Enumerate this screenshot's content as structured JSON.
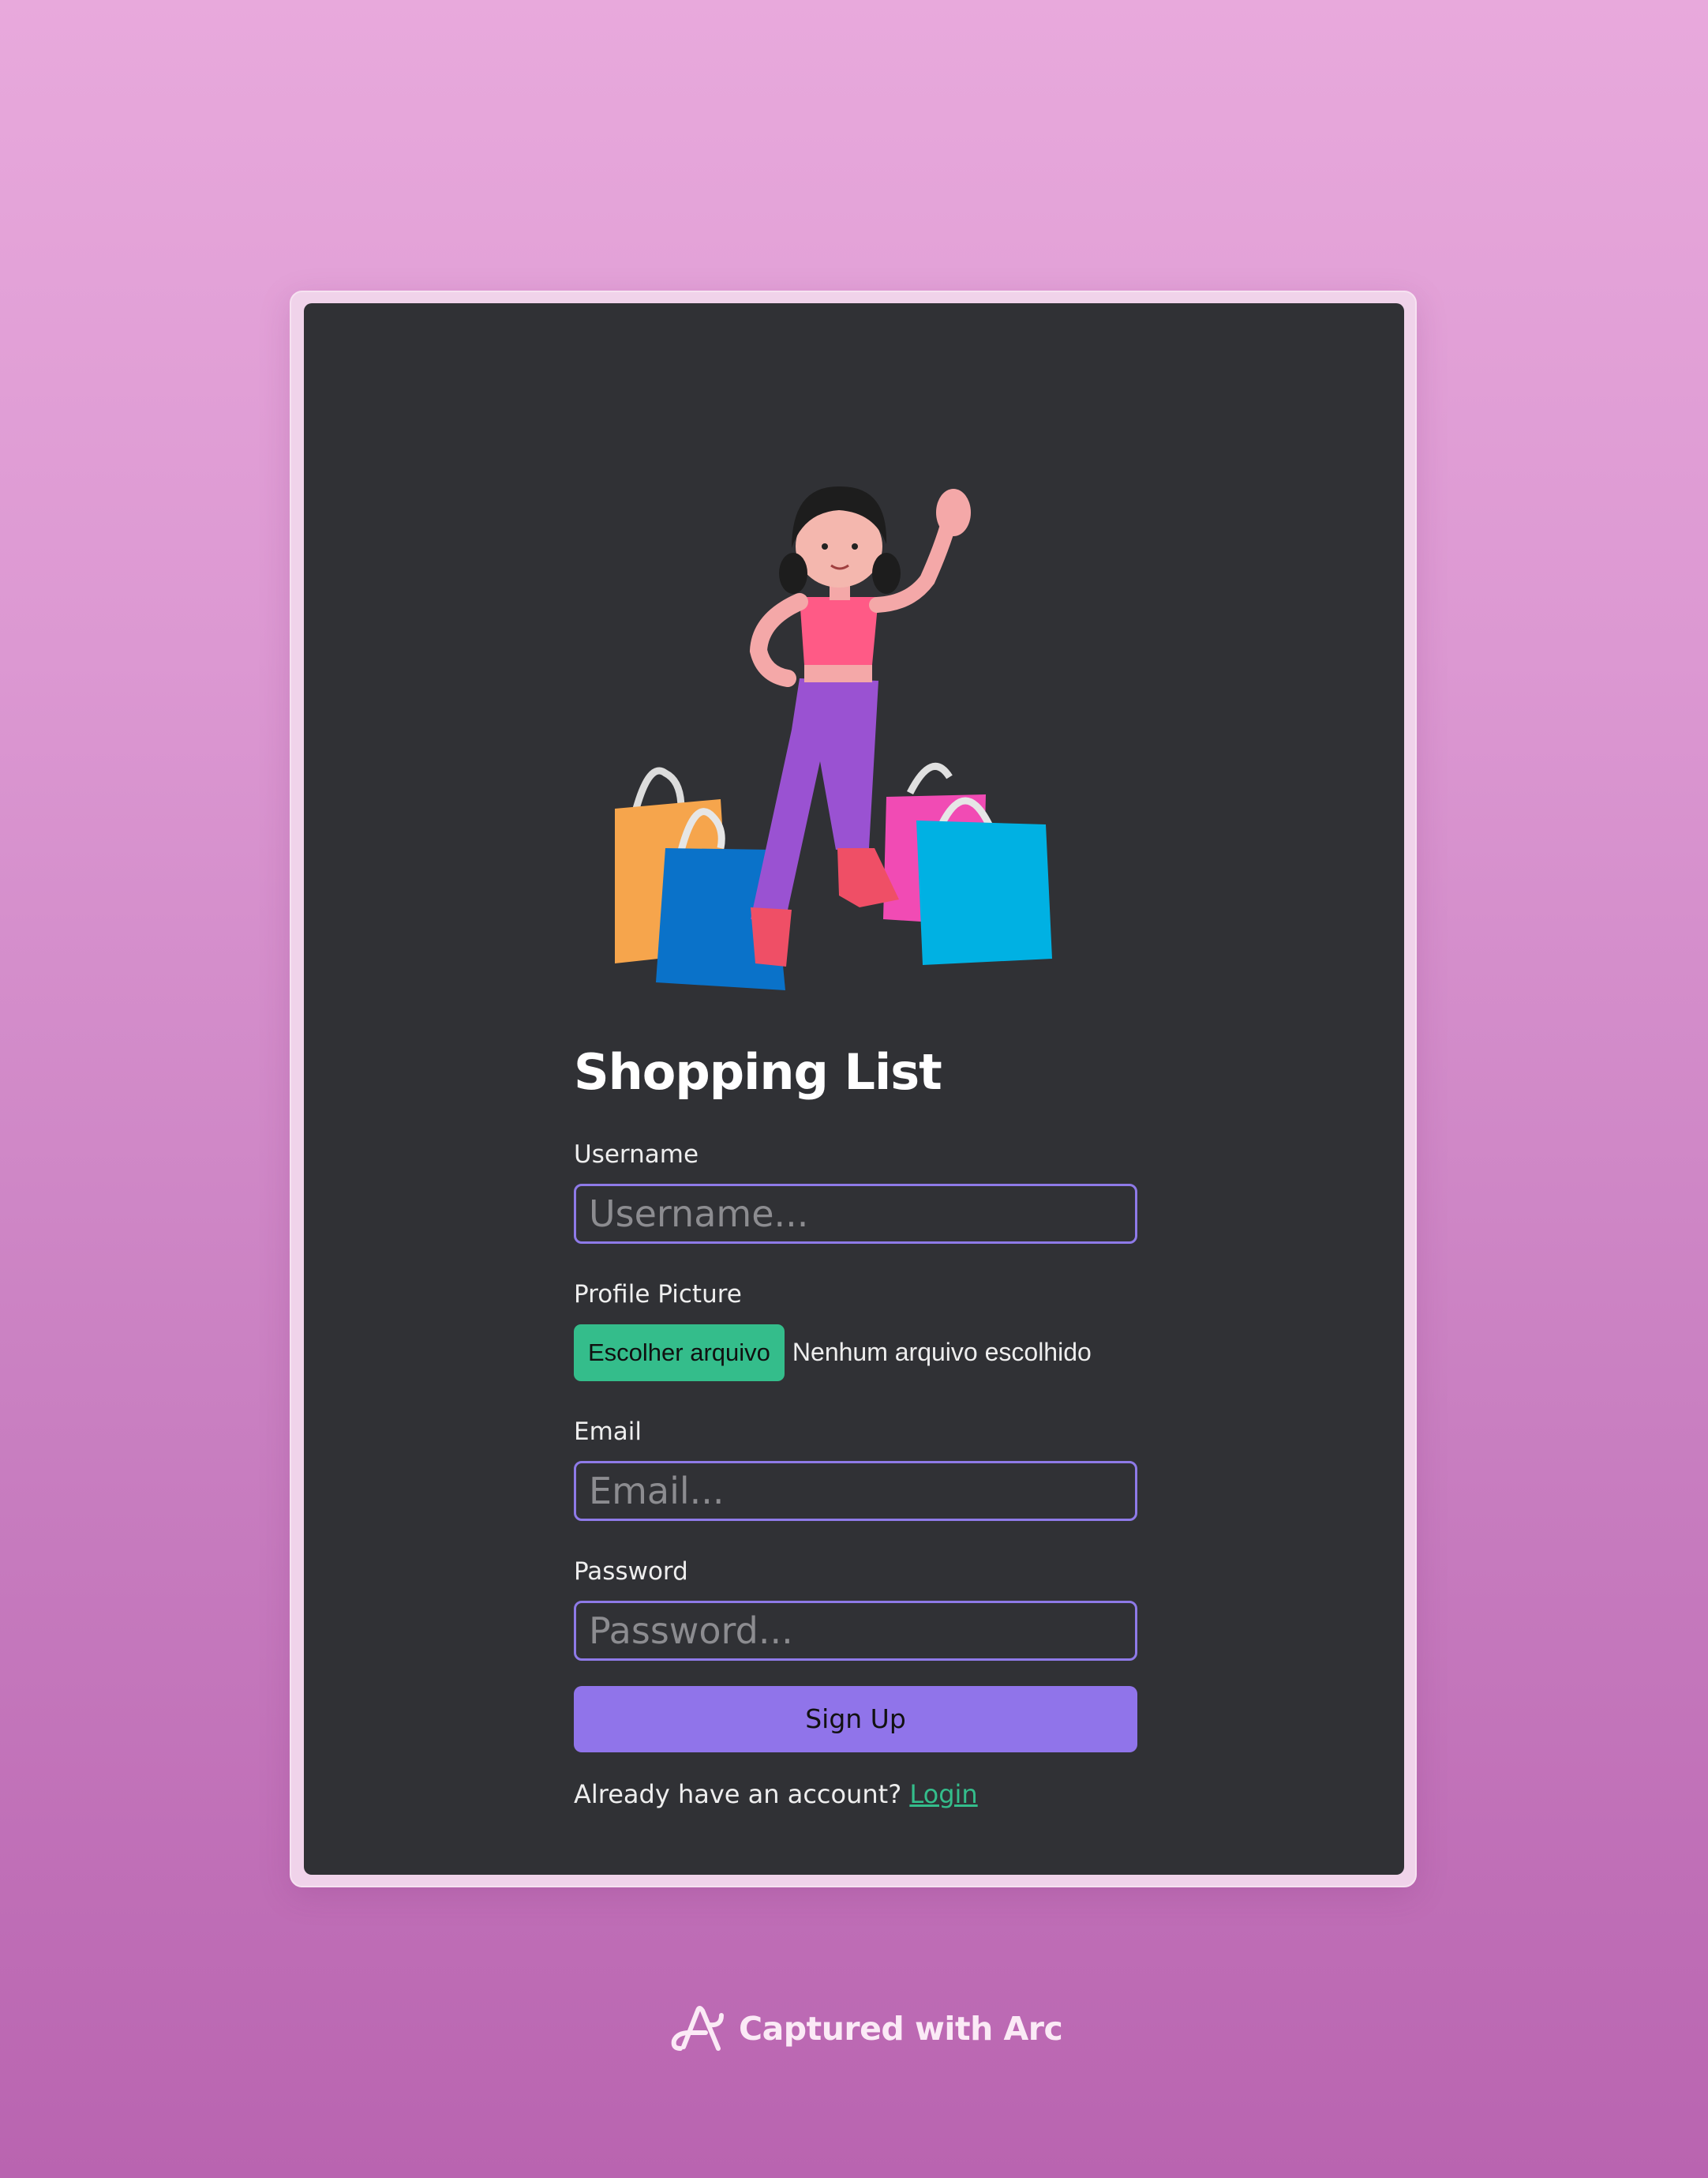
{
  "app": {
    "title": "Shopping List"
  },
  "form": {
    "username_label": "Username",
    "username_placeholder": "Username...",
    "profile_label": "Profile Picture",
    "file_button_label": "Escolher arquivo",
    "file_status": "Nenhum arquivo escolhido",
    "email_label": "Email",
    "email_placeholder": "Email...",
    "password_label": "Password",
    "password_placeholder": "Password...",
    "submit_label": "Sign Up",
    "account_prompt": "Already have an account?",
    "login_link": "Login"
  },
  "footer": {
    "capture_text": "Captured with Arc"
  },
  "colors": {
    "card_background": "#303135",
    "accent_purple": "#9074ea",
    "accent_green": "#34bd8b",
    "input_border": "#8e7ae8"
  },
  "icons": {
    "hero": "shopping-woman-illustration",
    "arc": "arc-logo-icon"
  }
}
